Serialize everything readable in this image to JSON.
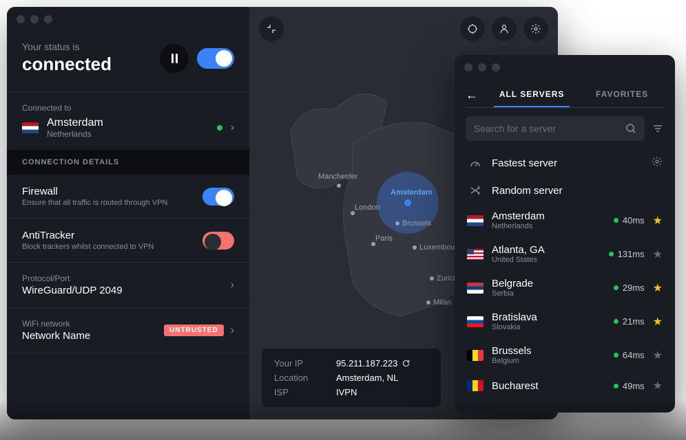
{
  "status": {
    "label": "Your status is",
    "value": "connected"
  },
  "connection": {
    "label": "Connected to",
    "city": "Amsterdam",
    "country": "Netherlands"
  },
  "details_header": "CONNECTION DETAILS",
  "firewall": {
    "title": "Firewall",
    "desc": "Ensure that all traffic is routed through VPN"
  },
  "antitracker": {
    "title": "AntiTracker",
    "desc": "Block trackers whilst connected to VPN"
  },
  "protocol": {
    "label": "Protocol/Port",
    "value": "WireGuard/UDP 2049"
  },
  "wifi": {
    "label": "WiFi network",
    "value": "Network Name",
    "badge": "UNTRUSTED"
  },
  "map_cities": {
    "manchester": "Manchester",
    "london": "London",
    "amsterdam": "Amsterdam",
    "brussels": "Brussels",
    "paris": "Paris",
    "luxembourg": "Luxembourg",
    "zurich": "Zurich",
    "milan": "Milan"
  },
  "ip_panel": {
    "ip_label": "Your IP",
    "ip_value": "95.211.187.223",
    "loc_label": "Location",
    "loc_value": "Amsterdam, NL",
    "isp_label": "ISP",
    "isp_value": "IVPN"
  },
  "server_window": {
    "tab_all": "ALL SERVERS",
    "tab_fav": "FAVORITES",
    "search_placeholder": "Search for a server",
    "fastest": "Fastest server",
    "random": "Random server",
    "servers": [
      {
        "city": "Amsterdam",
        "country": "Netherlands",
        "ping": "40ms",
        "fav": true,
        "flag": "nl"
      },
      {
        "city": "Atlanta, GA",
        "country": "United States",
        "ping": "131ms",
        "fav": false,
        "flag": "us"
      },
      {
        "city": "Belgrade",
        "country": "Serbia",
        "ping": "29ms",
        "fav": true,
        "flag": "rs"
      },
      {
        "city": "Bratislava",
        "country": "Slovakia",
        "ping": "21ms",
        "fav": true,
        "flag": "sk"
      },
      {
        "city": "Brussels",
        "country": "Belgium",
        "ping": "64ms",
        "fav": false,
        "flag": "be"
      },
      {
        "city": "Bucharest",
        "country": "",
        "ping": "49ms",
        "fav": false,
        "flag": "ro"
      }
    ]
  }
}
